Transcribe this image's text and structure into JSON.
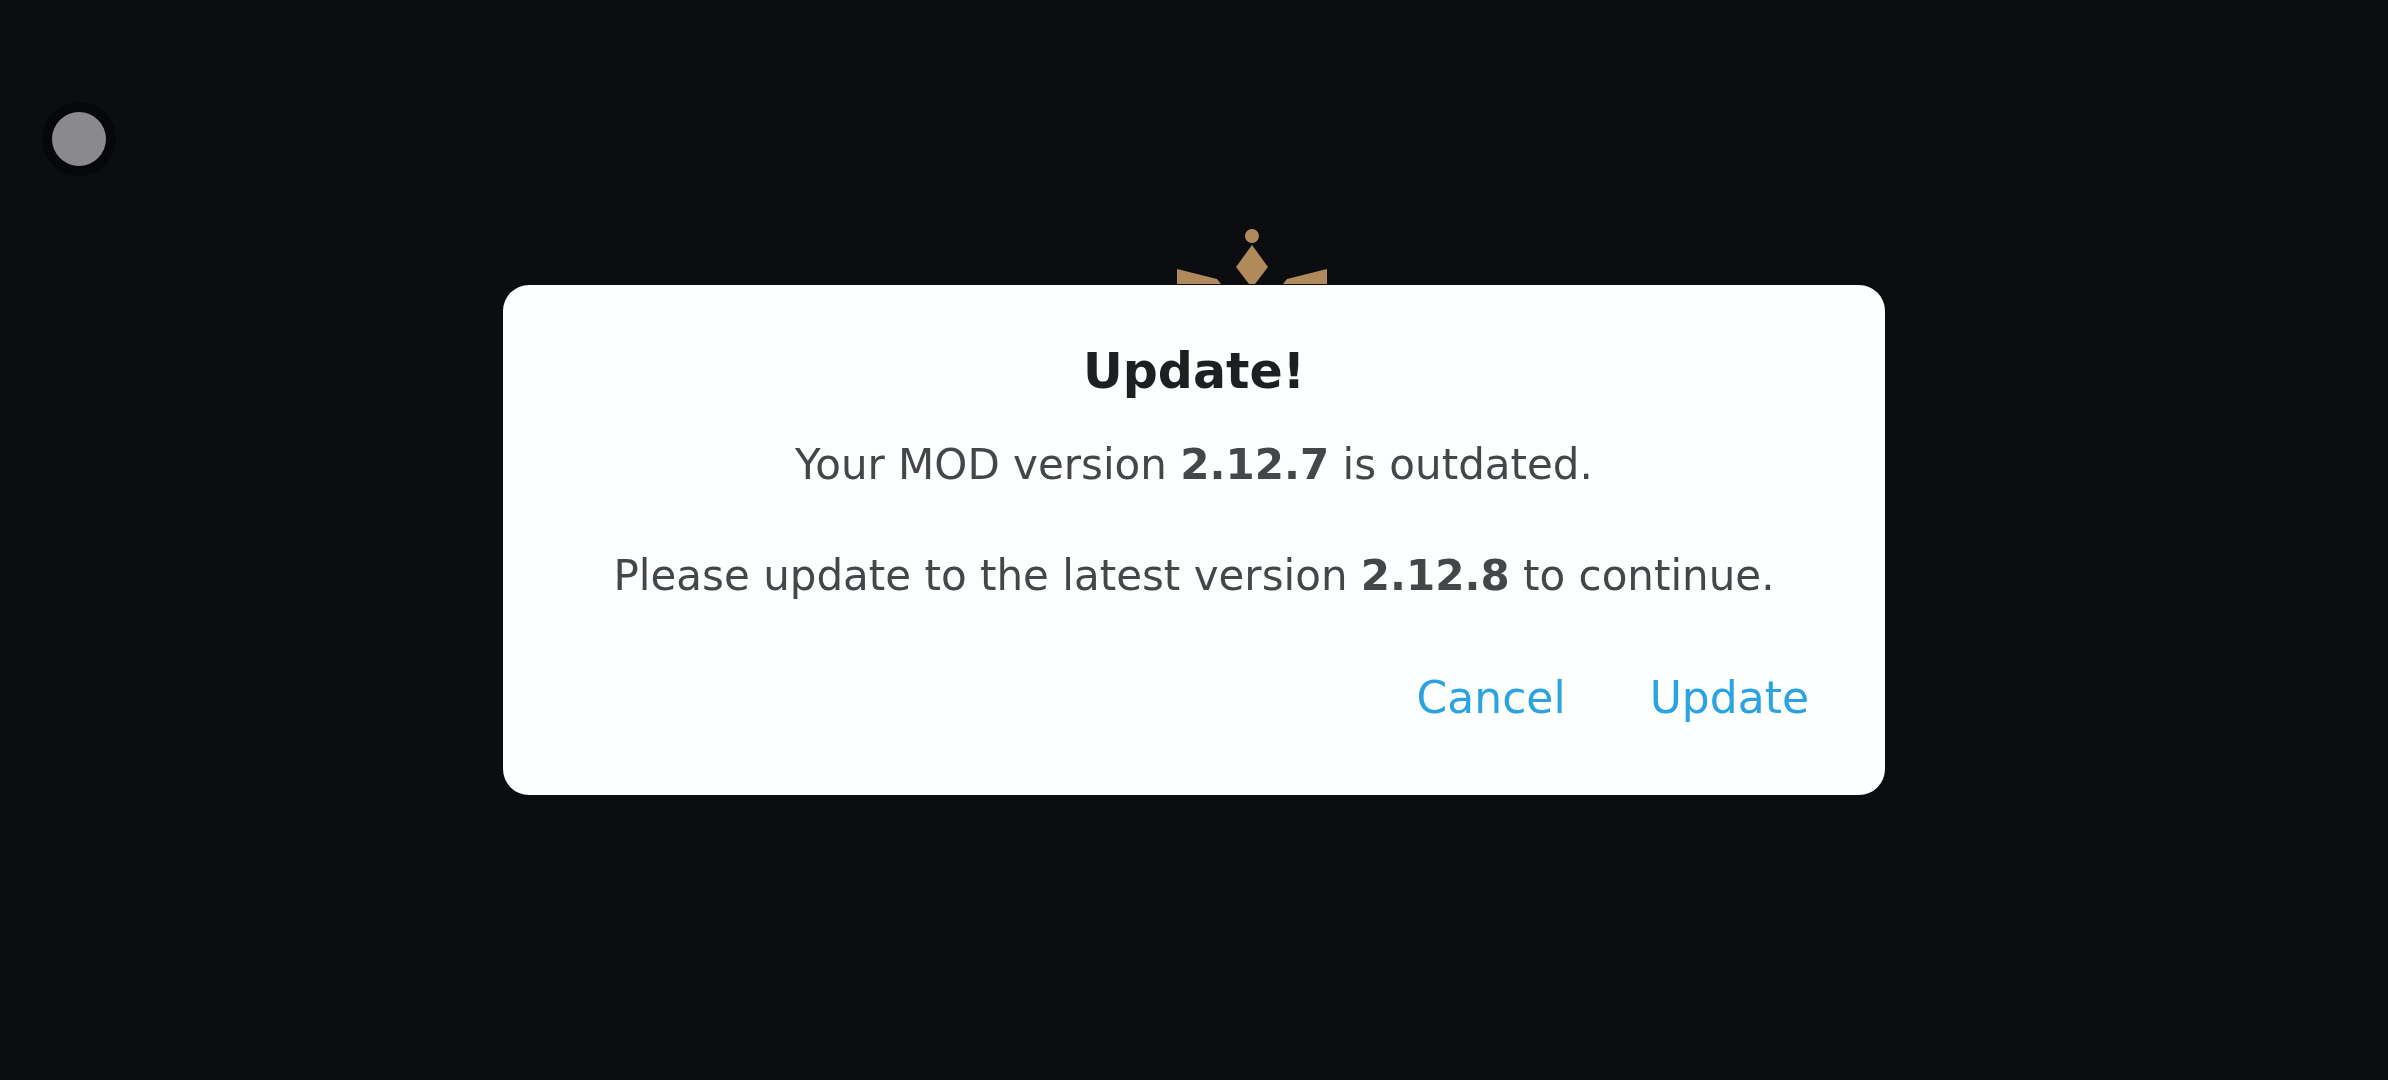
{
  "dialog": {
    "title": "Update!",
    "messages": [
      "Your MOD version **2.12.7** is outdated.",
      "Please update to the latest version **2.12.8** to continue."
    ],
    "buttons": [
      {
        "label": "Cancel"
      },
      {
        "label": "Update"
      }
    ]
  }
}
